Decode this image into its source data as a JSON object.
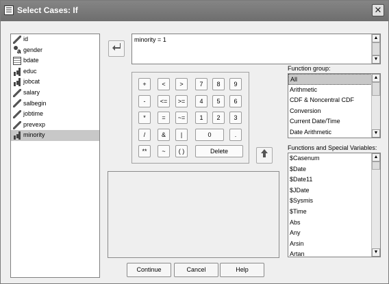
{
  "window": {
    "title": "Select Cases: If",
    "close_glyph": "✕"
  },
  "variables": [
    {
      "name": "id",
      "icon": "ruler-icon"
    },
    {
      "name": "gender",
      "icon": "nominal-string-icon"
    },
    {
      "name": "bdate",
      "icon": "date-icon"
    },
    {
      "name": "educ",
      "icon": "ordinal-icon"
    },
    {
      "name": "jobcat",
      "icon": "ordinal-icon"
    },
    {
      "name": "salary",
      "icon": "ruler-icon"
    },
    {
      "name": "salbegin",
      "icon": "ruler-icon"
    },
    {
      "name": "jobtime",
      "icon": "ruler-icon"
    },
    {
      "name": "prevexp",
      "icon": "ruler-icon"
    },
    {
      "name": "minority",
      "icon": "ordinal-icon",
      "selected": true
    }
  ],
  "expression": {
    "value": "minority = 1"
  },
  "keypad": {
    "keys": [
      "+",
      "<",
      ">",
      "7",
      "8",
      "9",
      "-",
      "<=",
      ">=",
      "4",
      "5",
      "6",
      "*",
      "=",
      "~=",
      "1",
      "2",
      "3",
      "/",
      "&",
      "|",
      "0",
      ".",
      "**",
      "~",
      "( )",
      "Delete"
    ]
  },
  "function_group": {
    "label": "Function group:",
    "items": [
      "All",
      "Arithmetic",
      "CDF & Noncentral CDF",
      "Conversion",
      "Current Date/Time",
      "Date Arithmetic"
    ],
    "selected": "All"
  },
  "functions": {
    "label": "Functions and Special Variables:",
    "items": [
      "$Casenum",
      "$Date",
      "$Date11",
      "$JDate",
      "$Sysmis",
      "$Time",
      "Abs",
      "Any",
      "Arsin",
      "Artan"
    ]
  },
  "buttons": {
    "continue": "Continue",
    "cancel": "Cancel",
    "help": "Help"
  }
}
